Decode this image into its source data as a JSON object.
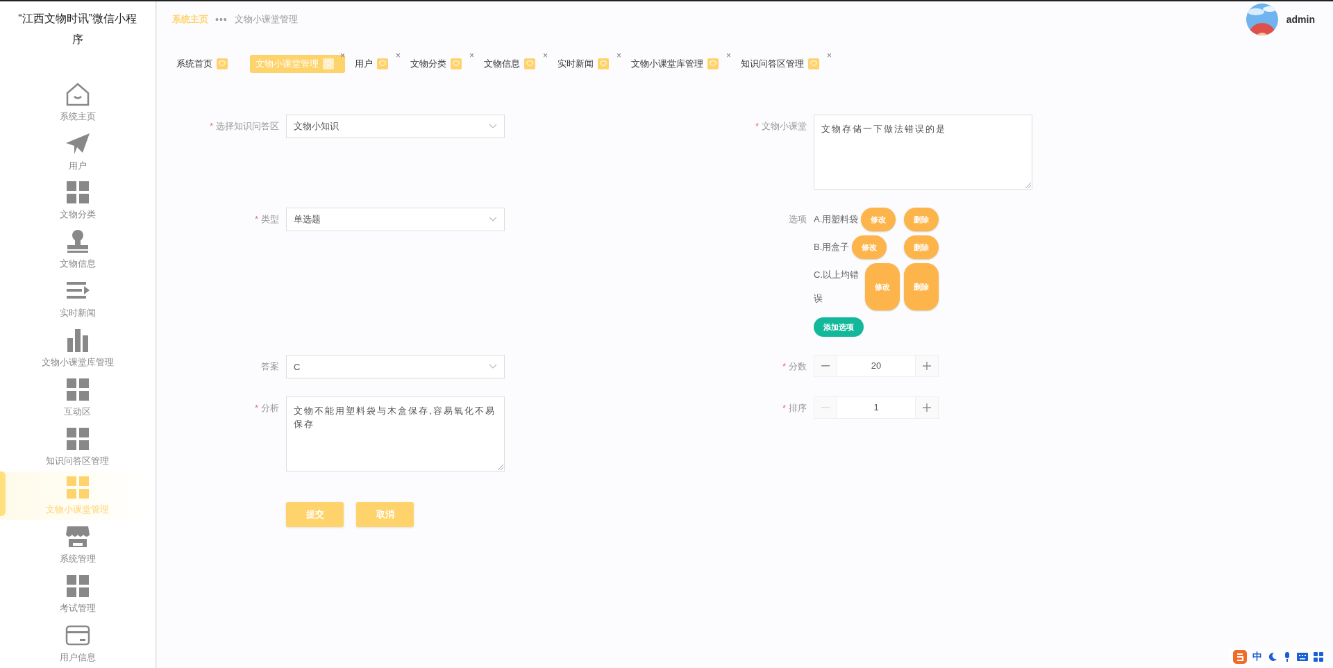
{
  "app_title": "“江西文物时讯”微信小程序",
  "sidebar": {
    "items": [
      {
        "label": "系统主页",
        "kind": "house",
        "selected": false
      },
      {
        "label": "用户",
        "kind": "plane",
        "selected": false
      },
      {
        "label": "文物分类",
        "kind": "grid",
        "selected": false
      },
      {
        "label": "文物信息",
        "kind": "stamp",
        "selected": false
      },
      {
        "label": "实时新闻",
        "kind": "list",
        "selected": false
      },
      {
        "label": "文物小课堂库管理",
        "kind": "bars",
        "selected": false
      },
      {
        "label": "互动区",
        "kind": "grid",
        "selected": false
      },
      {
        "label": "知识问答区管理",
        "kind": "grid",
        "selected": false
      },
      {
        "label": "文物小课堂管理",
        "kind": "grid",
        "selected": true
      },
      {
        "label": "系统管理",
        "kind": "shop",
        "selected": false
      },
      {
        "label": "考试管理",
        "kind": "grid",
        "selected": false
      },
      {
        "label": "用户信息",
        "kind": "card",
        "selected": false
      }
    ]
  },
  "breadcrumb": {
    "items": [
      "系统主页",
      "文物小课堂管理"
    ],
    "separator": "•••"
  },
  "user": {
    "name": "admin"
  },
  "tabs": [
    {
      "label": "系统首页",
      "selected": false
    },
    {
      "label": "文物小课堂管理",
      "selected": true,
      "close": "×"
    },
    {
      "label": "用户",
      "selected": false,
      "close": "×"
    },
    {
      "label": "文物分类",
      "selected": false,
      "close": "×"
    },
    {
      "label": "文物信息",
      "selected": false,
      "close": "×"
    },
    {
      "label": "实时新闻",
      "selected": false,
      "close": "×"
    },
    {
      "label": "文物小课堂库管理",
      "selected": false,
      "close": "×"
    },
    {
      "label": "知识问答区管理",
      "selected": false,
      "close": "×"
    }
  ],
  "form": {
    "rows": [
      [
        {
          "kind": "select",
          "label": "选择知识问答区",
          "required_mark": "*",
          "value": "文物小知识"
        },
        {
          "kind": "textarea",
          "label": "文物小课堂",
          "required_mark": "*",
          "value": "文物存储一下做法错误的是"
        }
      ],
      [
        {
          "kind": "select",
          "label": "类型",
          "required_mark": "*",
          "value": "单选题"
        },
        {
          "kind": "options",
          "label": "选项",
          "items": [
            {
              "text": "A.用塑料袋",
              "edit": "修改",
              "delete": "删除"
            },
            {
              "text": "B.用盒子",
              "edit": "修改",
              "delete": "删除"
            },
            {
              "text": "C.以上均错误",
              "edit": "修改",
              "delete": "删除"
            }
          ],
          "add": "添加选项"
        }
      ],
      [
        {
          "kind": "select",
          "label": "答案",
          "value": "C"
        },
        {
          "kind": "stepper",
          "label": "分数",
          "required_mark": "*",
          "value": "20",
          "minus_disabled": false
        }
      ],
      [
        {
          "kind": "textarea",
          "label": "分析",
          "required_mark": "*",
          "value": "文物不能用塑料袋与木盒保存,容易氧化不易保存"
        },
        {
          "kind": "stepper",
          "label": "排序",
          "required_mark": "*",
          "value": "1",
          "minus_disabled": true
        }
      ]
    ],
    "buttons": [
      "提交",
      "取消"
    ]
  },
  "ime_bar": {
    "label": "中"
  }
}
